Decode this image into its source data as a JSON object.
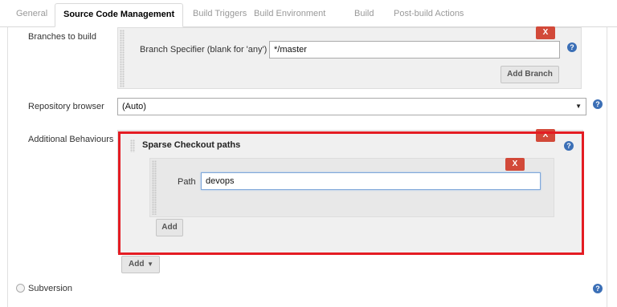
{
  "tabs": [
    {
      "label": "General"
    },
    {
      "label": "Source Code Management"
    },
    {
      "label": "Build Triggers"
    },
    {
      "label": "Build Environment"
    },
    {
      "label": "Build"
    },
    {
      "label": "Post-build Actions"
    }
  ],
  "branches": {
    "section_label": "Branches to build",
    "specifier_label": "Branch Specifier (blank for 'any')",
    "specifier_value": "*/master",
    "delete_label": "X",
    "add_branch_label": "Add Branch"
  },
  "repository_browser": {
    "label": "Repository browser",
    "selected": "(Auto)"
  },
  "additional_behaviours": {
    "label": "Additional Behaviours",
    "delete_label": "X",
    "sparse": {
      "title": "Sparse Checkout paths",
      "delete_label": "X",
      "path_label": "Path",
      "path_value": "devops",
      "add_label": "Add"
    },
    "add_dropdown_label": "Add"
  },
  "subversion": {
    "label": "Subversion"
  },
  "help_glyph": "?",
  "colors": {
    "delete_button": "#d24939",
    "highlight_frame": "#e41c23",
    "help_icon": "#3b6fb6"
  }
}
